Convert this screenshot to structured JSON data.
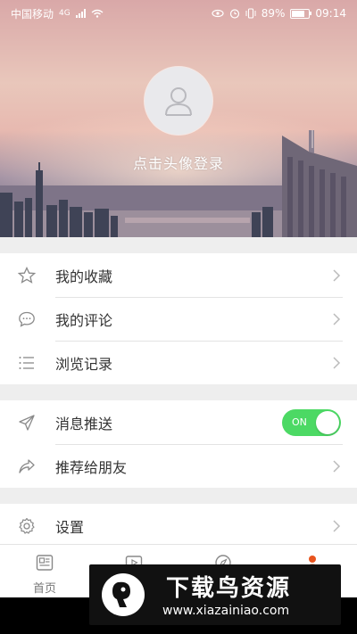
{
  "status_bar": {
    "carrier": "中国移动",
    "network": "4G",
    "battery": "89%",
    "battery_level": 0.89,
    "time": "09:14"
  },
  "profile": {
    "login_text": "点击头像登录"
  },
  "menu": {
    "group1": [
      {
        "label": "我的收藏",
        "icon": "star-icon"
      },
      {
        "label": "我的评论",
        "icon": "comment-icon"
      },
      {
        "label": "浏览记录",
        "icon": "list-icon"
      }
    ],
    "group2": [
      {
        "label": "消息推送",
        "icon": "send-icon",
        "toggle": "ON",
        "toggle_on": true
      },
      {
        "label": "推荐给朋友",
        "icon": "share-icon"
      }
    ],
    "group3": [
      {
        "label": "设置",
        "icon": "gear-icon"
      }
    ]
  },
  "tabs": [
    {
      "label": "首页",
      "icon": "news-icon"
    },
    {
      "label": "",
      "icon": "video-icon"
    },
    {
      "label": "",
      "icon": "discover-icon"
    },
    {
      "label": "",
      "icon": "user-icon"
    }
  ],
  "watermark": {
    "title": "下载鸟资源",
    "url": "www.xiazainiao.com"
  },
  "colors": {
    "toggle_on": "#4cd964",
    "active_tab": "#e8541e"
  }
}
